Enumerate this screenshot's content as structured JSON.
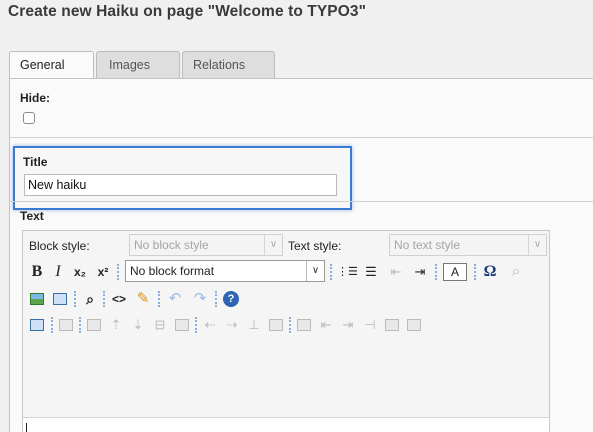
{
  "page": {
    "title": "Create new Haiku on page \"Welcome to TYPO3\""
  },
  "tabs": [
    {
      "label": "General",
      "active": true
    },
    {
      "label": "Images",
      "active": false
    },
    {
      "label": "Relations",
      "active": false
    }
  ],
  "fields": {
    "hide": {
      "label": "Hide:",
      "checked": false
    },
    "title": {
      "label": "Title",
      "value": "New haiku"
    },
    "text": {
      "label": "Text"
    }
  },
  "editor": {
    "block_style": {
      "label": "Block style:",
      "value": "No block style"
    },
    "text_style": {
      "label": "Text style:",
      "value": "No text style"
    },
    "block_format": {
      "value": "No block format"
    },
    "glyphs": {
      "bold": "B",
      "italic": "I",
      "subscript": "x₂",
      "superscript": "x²",
      "ordered_list": "⋮☰",
      "unordered_list": "☰",
      "outdent": "⇤",
      "indent": "⇥",
      "text_color": "A",
      "special_char": "Ω",
      "find": "⌕",
      "source": "<>",
      "undo": "↶",
      "redo": "↷",
      "help": "?"
    }
  },
  "colors": {
    "focus_border": "#3a7bd0",
    "separator": "#8ab0de"
  }
}
